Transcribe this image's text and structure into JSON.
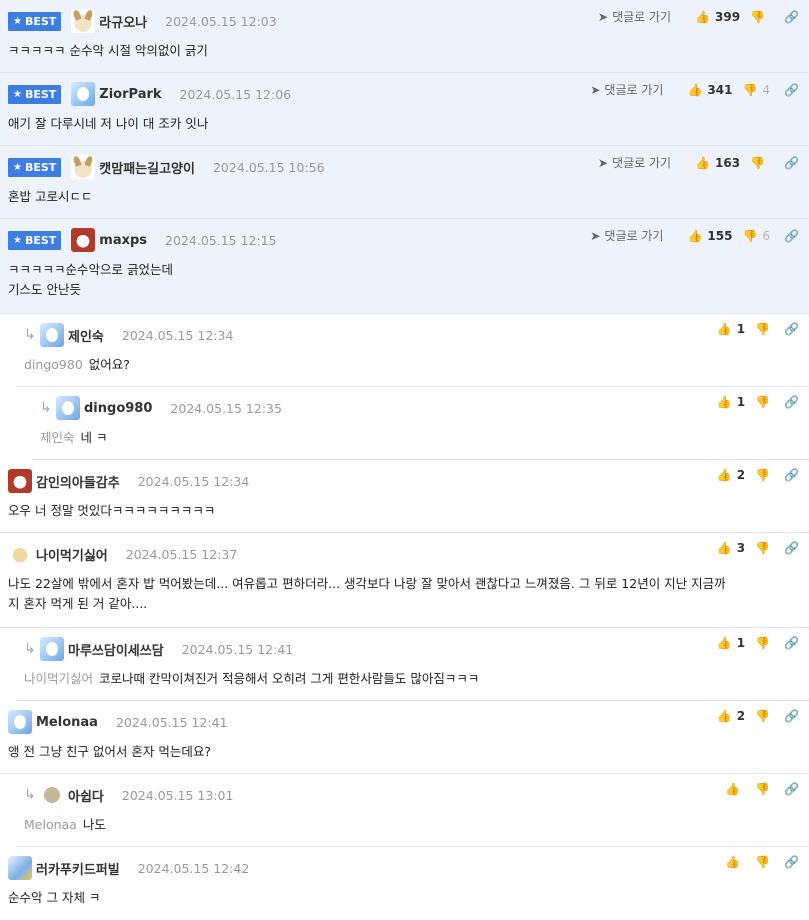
{
  "best_label": "BEST",
  "goto_label": "댓글로 가기",
  "comments": [
    {
      "nick": "라규오나",
      "date": "2024.05.15 12:03",
      "text": "ㅋㅋㅋㅋㅋ 순수악 시절 악의없이 긁기",
      "likes": "399",
      "dislikes": ""
    },
    {
      "nick": "ZiorPark",
      "date": "2024.05.15 12:06",
      "text": "애기 잘 다루시네 저 나이 대 조카 잇나",
      "likes": "341",
      "dislikes": "4"
    },
    {
      "nick": "캣맘패는길고양이",
      "date": "2024.05.15 10:56",
      "text": "혼밥 고로시ㄷㄷ",
      "likes": "163",
      "dislikes": ""
    },
    {
      "nick": "maxps",
      "date": "2024.05.15 12:15",
      "text1": "ㅋㅋㅋㅋㅋ순수악으로 긁었는데",
      "text2": "기스도 안난듯",
      "likes": "155",
      "dislikes": "6"
    },
    {
      "nick": "제인숙",
      "date": "2024.05.15 12:34",
      "target": "dingo980",
      "text": "없어요?",
      "likes": "1"
    },
    {
      "nick": "dingo980",
      "date": "2024.05.15 12:35",
      "target": "제인숙",
      "text": "네 ㅋ",
      "likes": "1"
    },
    {
      "nick": "감인의아들감추",
      "date": "2024.05.15 12:34",
      "text": "오우 너 정말 멋있다ㅋㅋㅋㅋㅋㅋㅋㅋㅋ",
      "likes": "2"
    },
    {
      "nick": "나이먹기싫어",
      "date": "2024.05.15 12:37",
      "text1": "나도 22살에 밖에서 혼자 밥 먹어봤는데... 여유롭고 편하더라... 생각보다 나랑 잘 맞아서 괜찮다고 느껴졌음. 그 뒤로 12년이 지난 지금까",
      "text2": "지 혼자 먹게 된 거 같아....",
      "likes": "3"
    },
    {
      "nick": "마루쓰담이세쓰담",
      "date": "2024.05.15 12:41",
      "target": "나이먹기싫어",
      "text": "코로나때 칸막이쳐진거 적응해서 오히려 그게 편한사람들도 많아짐ㅋㅋㅋ",
      "likes": "1"
    },
    {
      "nick": "Melonaa",
      "date": "2024.05.15 12:41",
      "text": "앵 전 그냥 친구 없어서 혼자 먹는데요?",
      "likes": "2"
    },
    {
      "nick": "아쉽다",
      "date": "2024.05.15 13:01",
      "target": "Melonaa",
      "text": "나도",
      "likes": ""
    },
    {
      "nick": "러카푸키드퍼빌",
      "date": "2024.05.15 12:42",
      "text": "순수악 그 자체 ㅋ",
      "likes": ""
    }
  ]
}
